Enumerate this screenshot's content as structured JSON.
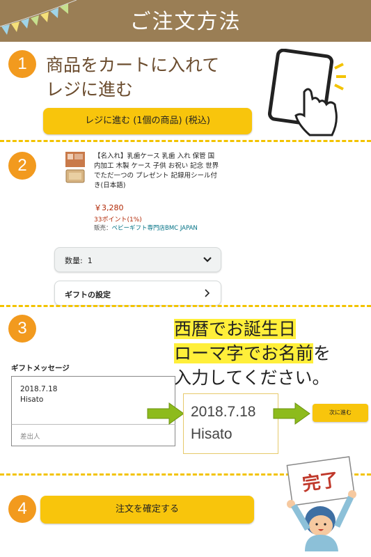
{
  "header": {
    "title": "ご注文方法"
  },
  "colors": {
    "header_bg": "#9a7e55",
    "step_circle": "#f29a1e",
    "button_yellow": "#f8c50c",
    "divider": "#f3c300",
    "highlight": "#ffef3a",
    "arrow_green": "#8dbb1c"
  },
  "step1": {
    "number": "1",
    "text_line1": "商品をカートに入れて",
    "text_line2": "レジに進む",
    "button_label": "レジに進む (1個の商品) (税込)",
    "icon": "tablet-tap-icon"
  },
  "step2": {
    "number": "2",
    "product": {
      "title": "【名入れ】乳歯ケース 乳歯 入れ 保管 国内加工 木製 ケース 子供 お祝い 記念 世界でただ一つの プレゼント 記録用シール付き(日本語)",
      "price": "￥3,280",
      "points": "33ポイント(1%)",
      "seller_prefix": "販売：",
      "seller_name": "ベビーギフト専門店BMC JAPAN"
    },
    "quantity_label": "数量:",
    "quantity_value": "1",
    "gift_settings_label": "ギフトの設定"
  },
  "step3": {
    "number": "3",
    "instruction_line1": "西暦でお誕生日",
    "instruction_line2_hl": "ローマ字でお名前",
    "instruction_line2_rest": "を",
    "instruction_line3": "入力してください。",
    "gift_message_label": "ギフトメッセージ",
    "message_line1": "2018.7.18",
    "message_line2": "Hisato",
    "sender_placeholder": "差出人",
    "zoom_line1": "2018.7.18",
    "zoom_line2": "Hisato",
    "next_button_label": "次に進む"
  },
  "step4": {
    "number": "4",
    "button_label": "注文を確定する",
    "sign_text": "完了"
  }
}
